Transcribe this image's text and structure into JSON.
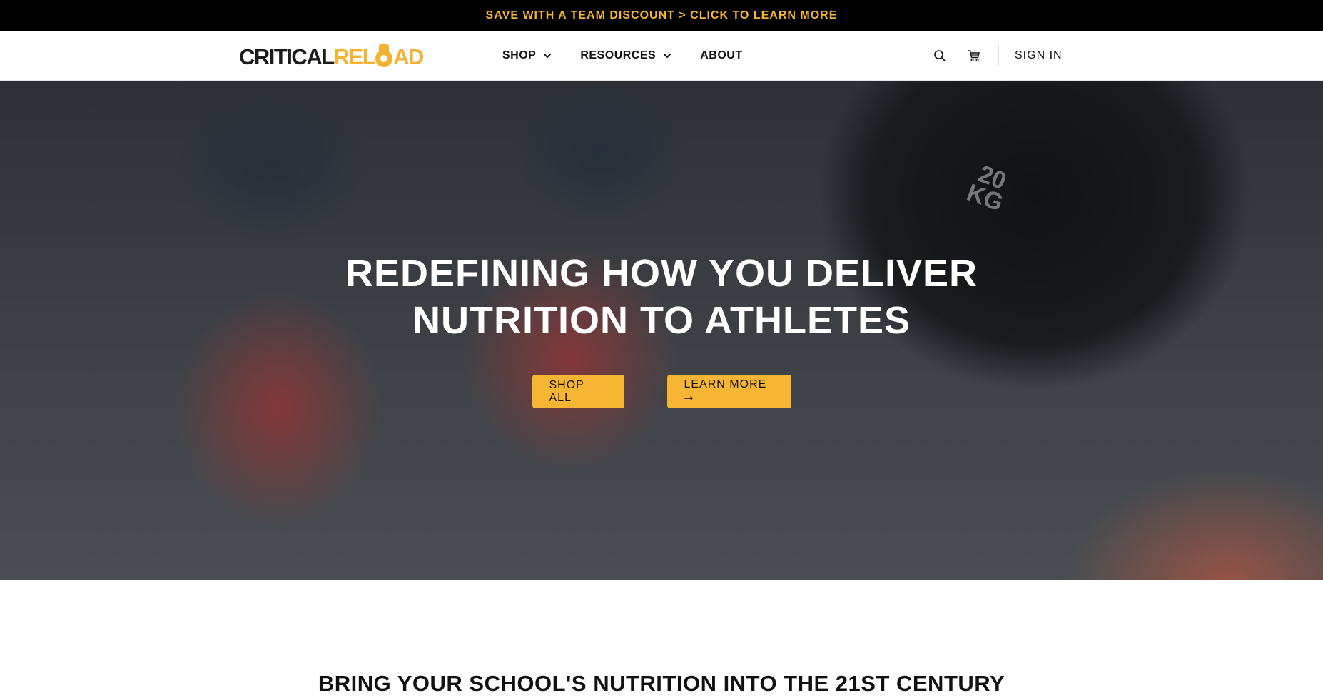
{
  "announcement": {
    "text": "SAVE WITH A TEAM DISCOUNT > CLICK TO LEARN MORE"
  },
  "logo": {
    "part1": "CRITICAL",
    "part2a": "REL",
    "part2b": "AD"
  },
  "nav": {
    "shop": "SHOP",
    "resources": "RESOURCES",
    "about": "ABOUT"
  },
  "header": {
    "sign_in": "SIGN IN",
    "search_icon": "search-icon",
    "cart_icon": "cart-icon"
  },
  "hero": {
    "title_line1": "REDEFINING HOW YOU DELIVER",
    "title_line2": "NUTRITION TO ATHLETES",
    "plate_text_1": "20",
    "plate_text_2": "KG",
    "shop_all": "SHOP ALL",
    "learn_more": "LEARN MORE ➞"
  },
  "section": {
    "title": "BRING YOUR SCHOOL'S NUTRITION INTO THE 21ST CENTURY"
  },
  "colors": {
    "accent": "#f6b533",
    "announcement_bg": "#000000"
  }
}
